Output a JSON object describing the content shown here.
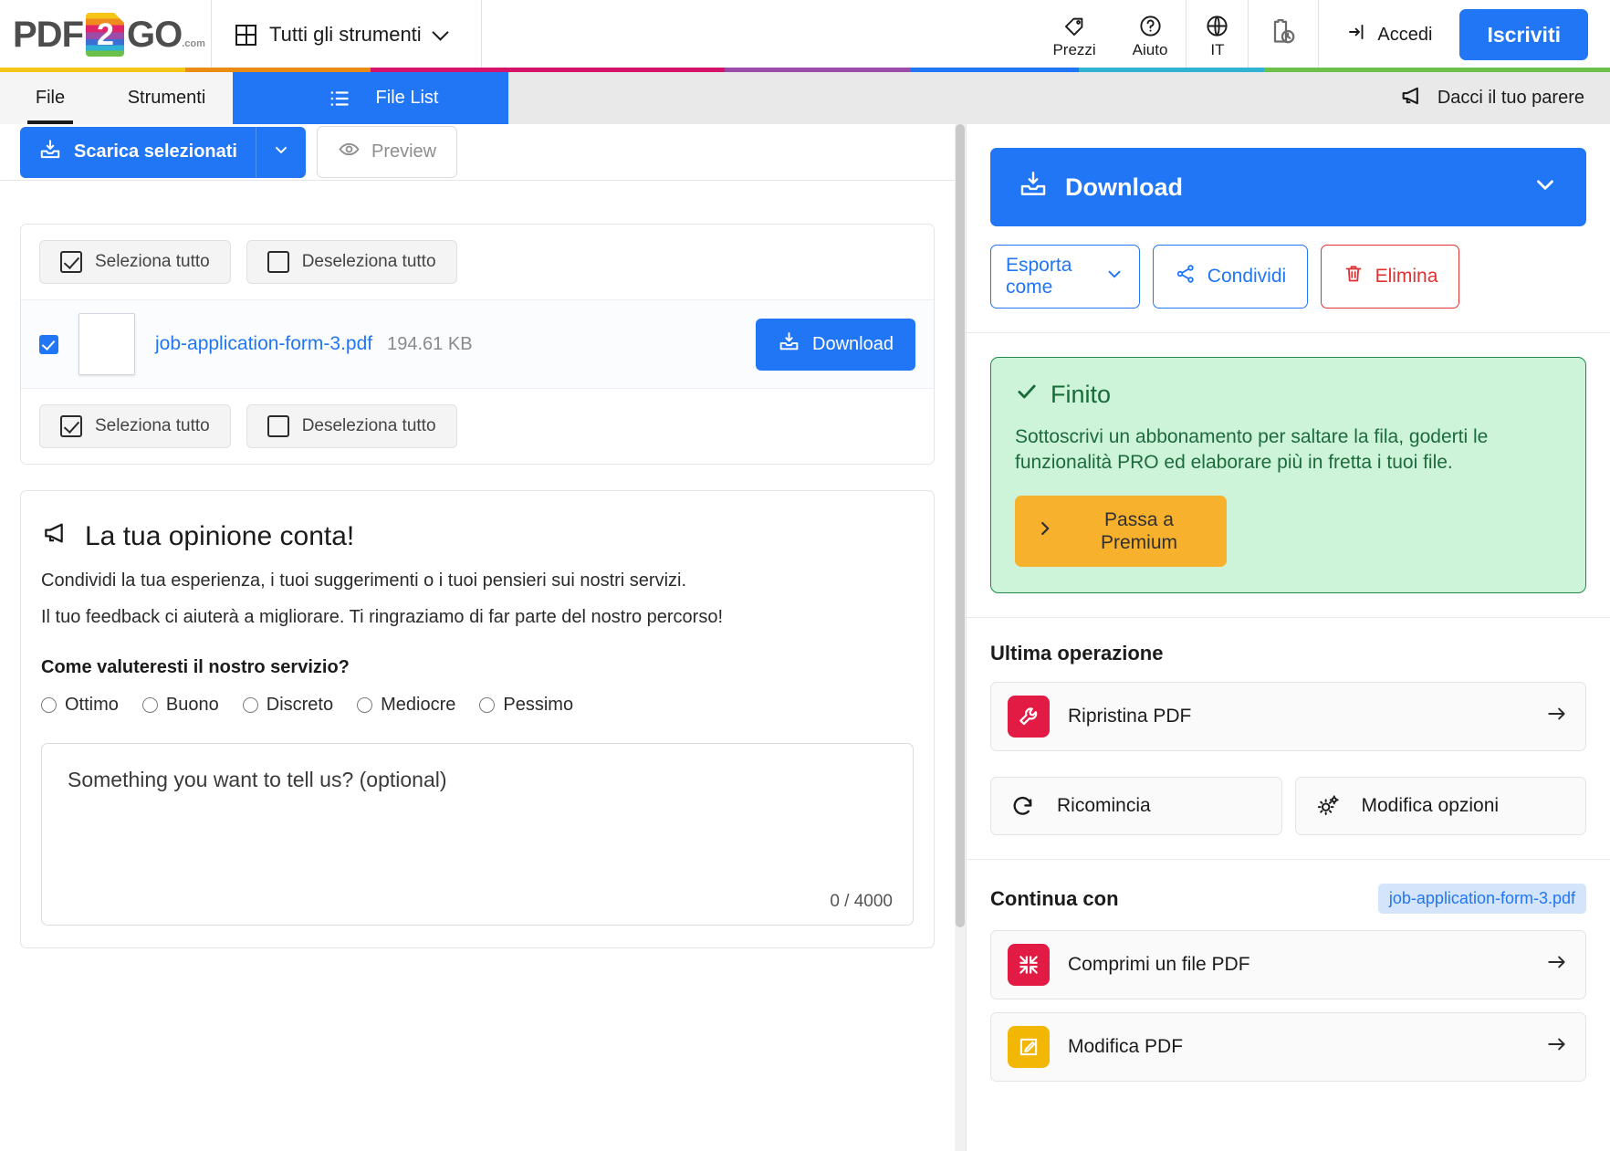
{
  "header": {
    "logo": {
      "pdf": "PDF",
      "two": "2",
      "go": "GO",
      "dotcom": ".com"
    },
    "tools_label": "Tutti gli strumenti",
    "items": [
      {
        "label": "Prezzi",
        "icon": "tag-icon"
      },
      {
        "label": "Aiuto",
        "icon": "question-circle-icon"
      },
      {
        "label": "IT",
        "icon": "globe-icon"
      }
    ],
    "history_icon": "clipboard-clock-icon",
    "login_label": "Accedi",
    "signup_label": "Iscriviti",
    "rainbow": [
      "#f5c518",
      "#ea8c13",
      "#d6136a",
      "#9b4ba8",
      "#2176f5",
      "#2fb2d4",
      "#6cc04a"
    ]
  },
  "tabs": {
    "file": "File",
    "strumenti": "Strumenti",
    "filelist": "File List",
    "filelist_icon": "list-icon",
    "feedback_link": "Dacci il tuo parere",
    "feedback_icon": "megaphone-icon"
  },
  "toolbar": {
    "download_selected": "Scarica selezionati",
    "download_icon": "download-tray-icon",
    "caret_icon": "chevron-down-icon",
    "preview": "Preview",
    "preview_icon": "eye-icon"
  },
  "filelist": {
    "select_all": "Seleziona tutto",
    "deselect_all": "Deseleziona tutto",
    "file": {
      "name": "job-application-form-3.pdf",
      "size": "194.61 KB",
      "download_label": "Download",
      "checked": true
    }
  },
  "feedback": {
    "title": "La tua opinione conta!",
    "title_icon": "megaphone-icon",
    "line1": "Condividi la tua esperienza, i tuoi suggerimenti o i tuoi pensieri sui nostri servizi.",
    "line2": "Il tuo feedback ci aiuterà a migliorare. Ti ringraziamo di far parte del nostro percorso!",
    "question": "Come valuteresti il nostro servizio?",
    "options": [
      "Ottimo",
      "Buono",
      "Discreto",
      "Mediocre",
      "Pessimo"
    ],
    "textarea_placeholder": "Something you want to tell us? (optional)",
    "char_count": "0 / 4000"
  },
  "sidebar": {
    "download_label": "Download",
    "download_icon": "download-tray-icon",
    "download_caret": "chevron-down-icon",
    "export_label": "Esporta come",
    "export_icon": "chevron-down-icon",
    "share_label": "Condividi",
    "share_icon": "share-nodes-icon",
    "delete_label": "Elimina",
    "delete_icon": "trash-icon",
    "status": {
      "title": "Finito",
      "title_icon": "check-icon",
      "body": "Sottoscrivi un abbonamento per saltare la fila, goderti le funzionalità PRO ed elaborare più in fretta i tuoi file.",
      "cta": "Passa a Premium",
      "cta_icon": "chevron-right-icon"
    },
    "last_operation": {
      "heading": "Ultima operazione",
      "primary": {
        "label": "Ripristina PDF",
        "icon": "wrench-icon",
        "color": "#e21b45",
        "arrow": "arrow-right-icon"
      },
      "restart": {
        "label": "Ricomincia",
        "icon": "rotate-right-icon"
      },
      "options": {
        "label": "Modifica opzioni",
        "icon": "gears-icon"
      }
    },
    "continue_with": {
      "heading": "Continua con",
      "chip": "job-application-form-3.pdf",
      "items": [
        {
          "label": "Comprimi un file PDF",
          "icon": "compress-icon",
          "color": "#e21b45",
          "arrow": "arrow-right-icon"
        },
        {
          "label": "Modifica PDF",
          "icon": "pencil-square-icon",
          "color": "#f2b705",
          "arrow": "arrow-right-icon"
        }
      ]
    }
  },
  "colors": {
    "brand_blue": "#2176f5",
    "success_green": "#1f8a4c",
    "danger_red": "#e03131",
    "premium_amber": "#f8b12c"
  }
}
